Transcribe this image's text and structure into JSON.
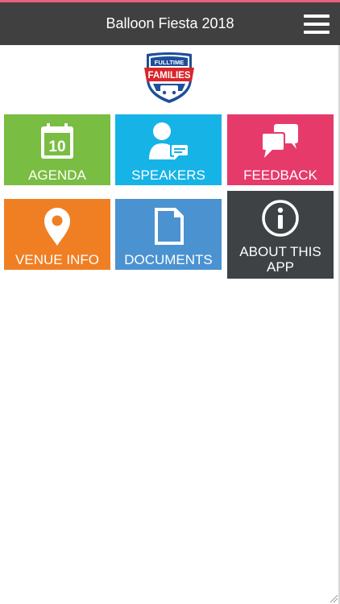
{
  "colors": {
    "header_bg": "#404040",
    "top_accent": "#e8607c",
    "agenda": "#79bd42",
    "speakers": "#16b3e6",
    "feedback": "#e63a6b",
    "venue": "#f07f23",
    "documents": "#4b92d1",
    "about": "#3e4245"
  },
  "header": {
    "title": "Balloon Fiesta 2018",
    "menu_icon": "hamburger-menu-icon"
  },
  "logo": {
    "top_text": "FULLTIME",
    "main_text": "FAMILIES"
  },
  "tiles": [
    {
      "label": "AGENDA",
      "icon": "calendar-icon",
      "calendar_day": "10"
    },
    {
      "label": "SPEAKERS",
      "icon": "speaker-chat-icon"
    },
    {
      "label": "FEEDBACK",
      "icon": "speech-bubbles-icon"
    },
    {
      "label": "VENUE INFO",
      "icon": "map-pin-icon"
    },
    {
      "label": "DOCUMENTS",
      "icon": "document-icon"
    },
    {
      "label": "ABOUT THIS APP",
      "icon": "info-circle-icon"
    }
  ]
}
